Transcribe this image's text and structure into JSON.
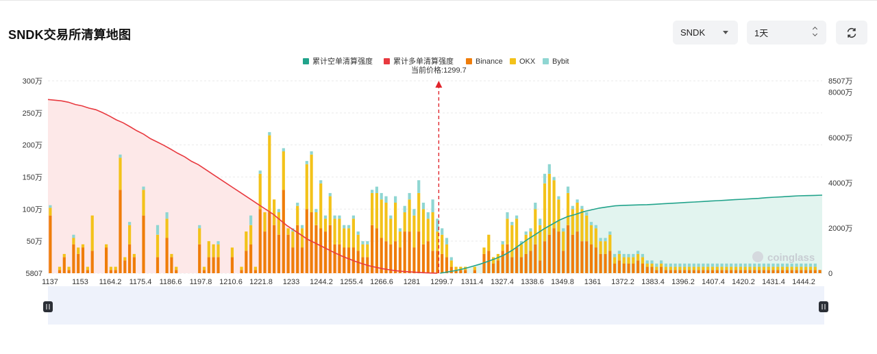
{
  "header": {
    "title": "SNDK交易所清算地图",
    "symbol": "SNDK",
    "range": "1天"
  },
  "colors": {
    "short_line": "#21a38b",
    "long_line": "#e8393f",
    "binance": "#ef7d0a",
    "okx": "#f3c21a",
    "bybit": "#8fd6d2",
    "long_fill": "#fde8e8",
    "short_fill": "#e2f4ef"
  },
  "chart_data": {
    "type": "bar",
    "legend": [
      "累计空单清算强度",
      "累计多单清算强度",
      "Binance",
      "OKX",
      "Bybit"
    ],
    "legend_position": "top-center",
    "current_price_label": "当前价格:1299.7",
    "current_price": 1299.7,
    "x_tick_labels": [
      "1137",
      "1153",
      "1164.2",
      "1175.4",
      "1186.6",
      "1197.8",
      "1210.6",
      "1221.8",
      "1233",
      "1244.2",
      "1255.4",
      "1266.6",
      "1281",
      "1299.7",
      "1311.4",
      "1327.4",
      "1338.6",
      "1349.8",
      "1361",
      "1372.2",
      "1383.4",
      "1396.2",
      "1407.4",
      "1420.2",
      "1431.4",
      "1444.2"
    ],
    "y_left_ticks": [
      "5807",
      "50万",
      "100万",
      "150万",
      "200万",
      "250万",
      "300万"
    ],
    "y_left_range": [
      0,
      3000000
    ],
    "y_right_ticks": [
      "0",
      "2000万",
      "4000万",
      "6000万",
      "8000万",
      "8507万"
    ],
    "y_right_range": [
      0,
      85070000
    ],
    "grid": true,
    "watermark": "coinglass",
    "series": [
      {
        "name": "Binance",
        "values": [
          90,
          0,
          5,
          25,
          5,
          45,
          30,
          40,
          5,
          35,
          0,
          0,
          40,
          5,
          5,
          130,
          20,
          45,
          25,
          0,
          90,
          0,
          0,
          25,
          0,
          55,
          25,
          5,
          0,
          0,
          0,
          0,
          45,
          5,
          25,
          25,
          25,
          0,
          0,
          25,
          0,
          5,
          35,
          45,
          5,
          100,
          65,
          95,
          75,
          60,
          130,
          60,
          40,
          75,
          40,
          100,
          95,
          75,
          70,
          65,
          75,
          45,
          45,
          40,
          40,
          40,
          35,
          25,
          25,
          75,
          70,
          55,
          50,
          45,
          50,
          40,
          65,
          65,
          40,
          65,
          45,
          50,
          35,
          35,
          30,
          25,
          10,
          5,
          5,
          5,
          0,
          5,
          0,
          30,
          35,
          15,
          20,
          35,
          45,
          25,
          40,
          25,
          30,
          35,
          45,
          20,
          50,
          60,
          70,
          65,
          35,
          75,
          60,
          65,
          50,
          50,
          45,
          40,
          30,
          30,
          35,
          15,
          20,
          15,
          15,
          15,
          20,
          15,
          10,
          10,
          5,
          10,
          5,
          5,
          5,
          5,
          5,
          5,
          5,
          5,
          5,
          5,
          5,
          5,
          5,
          5,
          5,
          5,
          5,
          5,
          5,
          5,
          5,
          5,
          5,
          5,
          5,
          5,
          5,
          5,
          5,
          5,
          5,
          5,
          5,
          5
        ]
      },
      {
        "name": "OKX",
        "values": [
          12,
          0,
          5,
          5,
          5,
          10,
          10,
          5,
          5,
          55,
          0,
          0,
          5,
          5,
          5,
          50,
          5,
          30,
          5,
          0,
          40,
          0,
          0,
          35,
          0,
          30,
          5,
          5,
          0,
          0,
          0,
          0,
          25,
          5,
          25,
          20,
          20,
          0,
          0,
          15,
          0,
          5,
          30,
          30,
          5,
          55,
          30,
          120,
          40,
          35,
          60,
          10,
          25,
          30,
          30,
          70,
          90,
          20,
          70,
          20,
          45,
          40,
          40,
          30,
          30,
          45,
          25,
          20,
          20,
          50,
          55,
          60,
          60,
          40,
          60,
          25,
          30,
          50,
          50,
          60,
          55,
          35,
          60,
          30,
          30,
          20,
          10,
          5,
          5,
          5,
          0,
          5,
          0,
          10,
          25,
          10,
          10,
          10,
          40,
          50,
          45,
          20,
          30,
          30,
          55,
          55,
          90,
          95,
          75,
          50,
          30,
          50,
          40,
          45,
          50,
          40,
          30,
          30,
          20,
          20,
          25,
          10,
          10,
          10,
          10,
          10,
          10,
          10,
          5,
          5,
          5,
          5,
          5,
          5,
          5,
          5,
          5,
          5,
          5,
          5,
          5,
          5,
          5,
          5,
          5,
          5,
          5,
          5,
          5,
          5,
          5,
          5,
          5,
          5,
          5,
          5,
          5,
          5,
          5,
          5,
          5,
          5,
          5,
          5,
          5
        ]
      },
      {
        "name": "Bybit",
        "values": [
          4,
          0,
          0,
          0,
          0,
          5,
          0,
          0,
          0,
          0,
          0,
          0,
          0,
          0,
          0,
          5,
          0,
          5,
          0,
          0,
          5,
          0,
          0,
          15,
          0,
          10,
          0,
          0,
          0,
          0,
          0,
          0,
          5,
          0,
          0,
          0,
          5,
          0,
          0,
          0,
          0,
          0,
          0,
          15,
          0,
          5,
          0,
          5,
          0,
          5,
          5,
          0,
          5,
          5,
          5,
          5,
          5,
          5,
          5,
          5,
          5,
          5,
          5,
          5,
          5,
          5,
          5,
          5,
          5,
          5,
          10,
          10,
          10,
          5,
          10,
          5,
          10,
          10,
          10,
          20,
          10,
          10,
          20,
          20,
          10,
          10,
          5,
          0,
          0,
          0,
          0,
          0,
          0,
          0,
          0,
          0,
          0,
          5,
          10,
          5,
          5,
          5,
          5,
          5,
          10,
          10,
          15,
          15,
          5,
          5,
          5,
          10,
          5,
          5,
          5,
          5,
          5,
          5,
          5,
          5,
          5,
          5,
          5,
          5,
          5,
          5,
          5,
          5,
          5,
          5,
          5,
          5,
          5,
          5,
          5,
          5,
          5,
          5,
          5,
          5,
          5,
          5,
          5,
          5,
          5,
          5,
          5,
          5,
          5,
          5,
          5,
          5,
          5,
          5,
          5,
          5,
          5,
          5,
          5,
          5,
          5,
          5,
          5,
          5,
          5
        ]
      }
    ],
    "cumulative_long_cliquidations": [
      7680,
      7650,
      7620,
      7560,
      7460,
      7400,
      7300,
      7230,
      7100,
      6950,
      6780,
      6650,
      6480,
      6300,
      6150,
      5950,
      5800,
      5650,
      5480,
      5300,
      5150,
      4950,
      4800,
      4600,
      4400,
      4200,
      4000,
      3800,
      3600,
      3400,
      3200,
      3000,
      2800,
      2600,
      2350,
      2100,
      1900,
      1700,
      1500,
      1350,
      1200,
      1050,
      900,
      760,
      640,
      520,
      420,
      330,
      260,
      200,
      150,
      110,
      80,
      60,
      40,
      20,
      10,
      0
    ],
    "cumulative_short_liquidations": [
      0,
      60,
      120,
      200,
      300,
      400,
      520,
      650,
      800,
      1000,
      1250,
      1500,
      1720,
      1950,
      2150,
      2350,
      2500,
      2600,
      2720,
      2800,
      2880,
      2930,
      2980,
      3000,
      3010,
      3020,
      3030,
      3050,
      3070,
      3090,
      3110,
      3130,
      3150,
      3170,
      3190,
      3210,
      3230,
      3250,
      3270,
      3290,
      3310,
      3340,
      3360,
      3380,
      3400,
      3420,
      3430,
      3440,
      3450
    ]
  }
}
